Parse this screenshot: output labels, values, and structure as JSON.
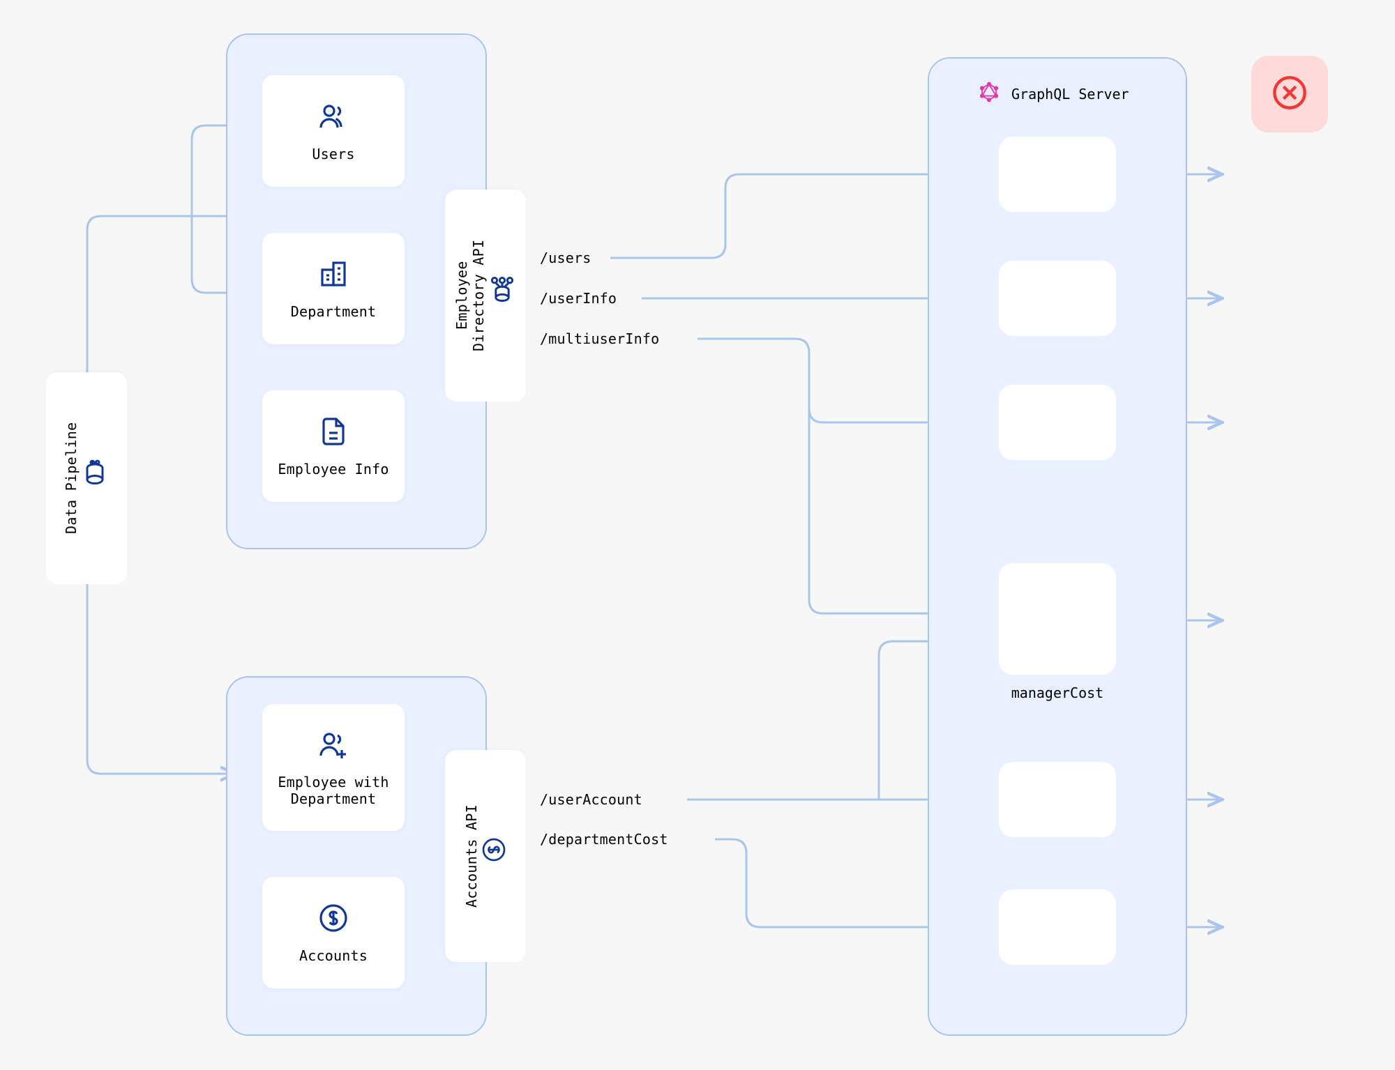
{
  "pipeline": {
    "label": "Data Pipeline"
  },
  "sourcesTop": {
    "users": {
      "label": "Users"
    },
    "department": {
      "label": "Department"
    },
    "employeeInfo": {
      "label": "Employee Info"
    }
  },
  "sourcesBottom": {
    "employeeDept": {
      "label": "Employee with\nDepartment"
    },
    "accounts": {
      "label": "Accounts"
    }
  },
  "apiTop": {
    "label": "Employee\nDirectory API"
  },
  "apiBottom": {
    "label": "Accounts API"
  },
  "endpoints": {
    "users": "/users",
    "userInfo": "/userInfo",
    "multiuserInfo": "/multiuserInfo",
    "userAccount": "/userAccount",
    "departmentCost": "/departmentCost"
  },
  "graphql": {
    "title": "GraphQL Server"
  },
  "resolvers": {
    "managerCost": "managerCost"
  },
  "colors": {
    "lineBlue": "#aac4ee",
    "boxBlue": "#eaf0ff",
    "darkBlue": "#103795",
    "pink": "#e535ab",
    "red": "#ed3833",
    "redBg": "#ffdada"
  }
}
